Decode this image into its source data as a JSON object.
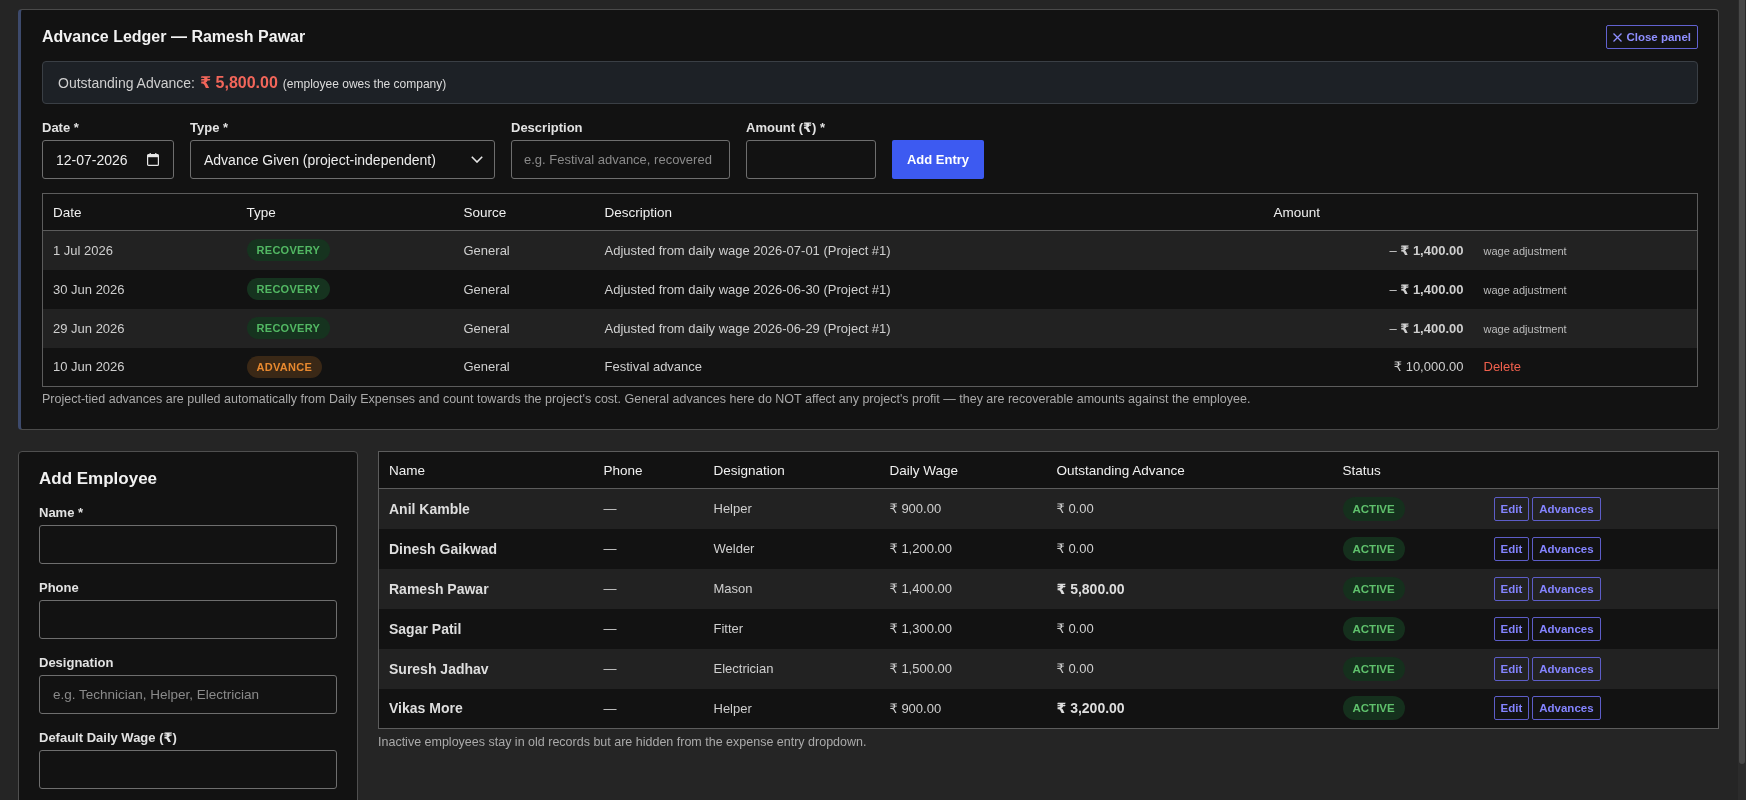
{
  "ledger_panel": {
    "title": "Advance Ledger — Ramesh Pawar",
    "close_button": "Close panel",
    "summary": {
      "label": "Outstanding Advance:",
      "amount": "₹ 5,800.00",
      "note": "(employee owes the company)"
    },
    "entry_form": {
      "fields": [
        {
          "kind": "date",
          "label": "Date *",
          "value": "12-07-2026"
        },
        {
          "kind": "select",
          "label": "Type *",
          "value": "Advance Given (project-independent)"
        },
        {
          "kind": "text",
          "label": "Description",
          "placeholder": "e.g. Festival advance, recovered"
        },
        {
          "kind": "text",
          "label": "Amount (₹) *"
        }
      ],
      "submit_button": "Add Entry"
    },
    "table": {
      "columns": [
        "Date",
        "Type",
        "Source",
        "Description",
        "Amount"
      ],
      "rows": [
        {
          "date": "1 Jul 2026",
          "type": "RECOVERY",
          "kind": "recovery",
          "source": "General",
          "description": "Adjusted from daily wage 2026-07-01 (Project #1)",
          "amount": "– **₹ 1,400.00**",
          "note": "wage adjustment"
        },
        {
          "date": "30 Jun 2026",
          "type": "RECOVERY",
          "kind": "recovery",
          "source": "General",
          "description": "Adjusted from daily wage 2026-06-30 (Project #1)",
          "amount": "– **₹ 1,400.00**",
          "note": "wage adjustment"
        },
        {
          "date": "29 Jun 2026",
          "type": "RECOVERY",
          "kind": "recovery",
          "source": "General",
          "description": "Adjusted from daily wage 2026-06-29 (Project #1)",
          "amount": "– **₹ 1,400.00**",
          "note": "wage adjustment"
        },
        {
          "date": "10 Jun 2026",
          "type": "ADVANCE",
          "kind": "advance",
          "source": "General",
          "description": "Festival advance",
          "amount": "₹ 10,000.00",
          "action": "Delete"
        }
      ]
    },
    "footnote": "Project-tied advances are pulled automatically from Daily Expenses and count towards the project's cost. General advances here do NOT affect any project's profit — they are recoverable amounts against the employee."
  },
  "add_employee": {
    "title": "Add Employee",
    "fields": [
      {
        "label": "Name *"
      },
      {
        "label": "Phone"
      },
      {
        "label": "Designation",
        "placeholder": "e.g. Technician, Helper, Electrician"
      },
      {
        "label": "Default Daily Wage (₹)"
      }
    ]
  },
  "employees": {
    "columns": [
      "Name",
      "Phone",
      "Designation",
      "Daily Wage",
      "Outstanding Advance",
      "Status"
    ],
    "rows": [
      {
        "name": "Anil Kamble",
        "phone": "—",
        "designation": "Helper",
        "daily_wage": "₹ 900.00",
        "outstanding": "₹ 0.00",
        "has_due": false,
        "status": "ACTIVE",
        "actions": [
          "Edit",
          "Advances"
        ]
      },
      {
        "name": "Dinesh Gaikwad",
        "phone": "—",
        "designation": "Welder",
        "daily_wage": "₹ 1,200.00",
        "outstanding": "₹ 0.00",
        "has_due": false,
        "status": "ACTIVE",
        "actions": [
          "Edit",
          "Advances"
        ]
      },
      {
        "name": "Ramesh Pawar",
        "phone": "—",
        "designation": "Mason",
        "daily_wage": "₹ 1,400.00",
        "outstanding": "₹ 5,800.00",
        "has_due": true,
        "status": "ACTIVE",
        "actions": [
          "Edit",
          "Advances"
        ]
      },
      {
        "name": "Sagar Patil",
        "phone": "—",
        "designation": "Fitter",
        "daily_wage": "₹ 1,300.00",
        "outstanding": "₹ 0.00",
        "has_due": false,
        "status": "ACTIVE",
        "actions": [
          "Edit",
          "Advances"
        ]
      },
      {
        "name": "Suresh Jadhav",
        "phone": "—",
        "designation": "Electrician",
        "daily_wage": "₹ 1,500.00",
        "outstanding": "₹ 0.00",
        "has_due": false,
        "status": "ACTIVE",
        "actions": [
          "Edit",
          "Advances"
        ]
      },
      {
        "name": "Vikas More",
        "phone": "—",
        "designation": "Helper",
        "daily_wage": "₹ 900.00",
        "outstanding": "₹ 3,200.00",
        "has_due": true,
        "status": "ACTIVE",
        "actions": [
          "Edit",
          "Advances"
        ]
      }
    ],
    "footnote": "Inactive employees stay in old records but are hidden from the expense entry dropdown."
  }
}
